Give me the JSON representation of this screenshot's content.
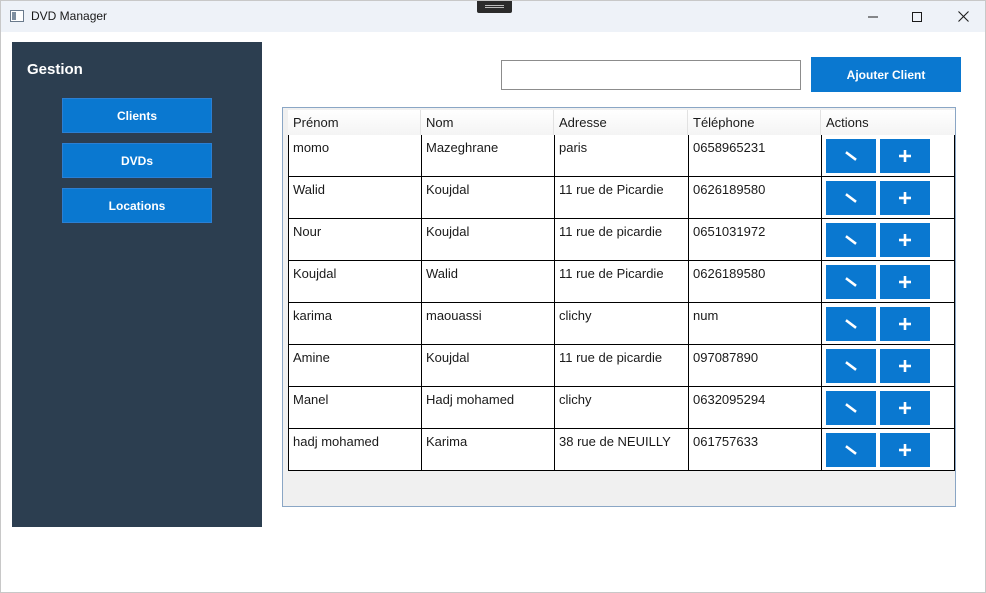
{
  "window": {
    "title": "DVD Manager"
  },
  "sidebar": {
    "title": "Gestion",
    "items": [
      {
        "label": "Clients"
      },
      {
        "label": "DVDs"
      },
      {
        "label": "Locations"
      }
    ],
    "background": "#2c3e50"
  },
  "toolbar": {
    "search_value": "",
    "search_placeholder": "",
    "add_label": "Ajouter Client"
  },
  "table": {
    "columns": [
      "Prénom",
      "Nom",
      "Adresse",
      "Téléphone",
      "Actions"
    ],
    "rows": [
      {
        "prenom": "momo",
        "nom": "Mazeghrane",
        "adresse": "paris",
        "telephone": "0658965231"
      },
      {
        "prenom": "Walid",
        "nom": "Koujdal",
        "adresse": "11 rue de Picardie",
        "telephone": "0626189580"
      },
      {
        "prenom": "Nour",
        "nom": "Koujdal",
        "adresse": "11 rue de picardie",
        "telephone": "0651031972"
      },
      {
        "prenom": "Koujdal",
        "nom": "Walid",
        "adresse": "11 rue de Picardie",
        "telephone": "0626189580"
      },
      {
        "prenom": "karima",
        "nom": "maouassi",
        "adresse": "clichy",
        "telephone": "num"
      },
      {
        "prenom": "Amine",
        "nom": "Koujdal",
        "adresse": "11 rue de picardie",
        "telephone": "097087890"
      },
      {
        "prenom": "Manel",
        "nom": "Hadj mohamed",
        "adresse": "clichy",
        "telephone": "0632095294"
      },
      {
        "prenom": "hadj mohamed",
        "nom": "Karima",
        "adresse": "38 rue de NEUILLY",
        "telephone": "061757633"
      }
    ],
    "row_actions": [
      {
        "icon": "edit-icon"
      },
      {
        "icon": "plus-icon"
      }
    ]
  },
  "colors": {
    "accent": "#0a78d0",
    "sidebar": "#2c3e50",
    "titlebar": "#eef2f8"
  }
}
